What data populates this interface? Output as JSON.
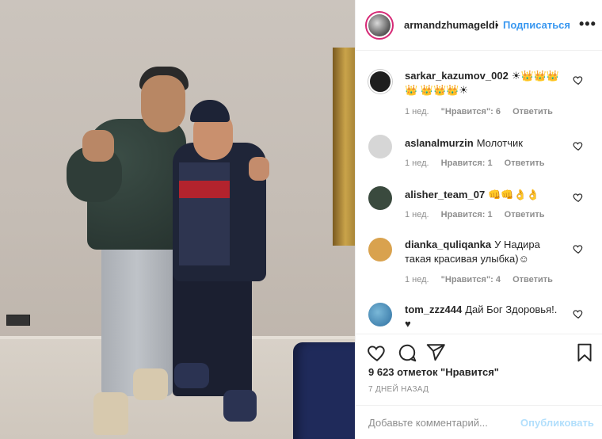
{
  "post": {
    "username": "armandzhumageldi",
    "separator": "•",
    "follow_label": "Подписаться",
    "more_label": "•••",
    "likes_text": "9 623 отметок \"Нравится\"",
    "time_ago": "7 ДНЕЙ НАЗАД"
  },
  "comments": [
    {
      "username": "sarkar_kazumov_002",
      "text": "☀👑👑👑👑 👑👑👑☀",
      "age": "1 нед.",
      "likes": "\"Нравится\": 6",
      "reply": "Ответить",
      "avatar_color": "#1e1e1e"
    },
    {
      "username": "aslanalmurzin",
      "text": "Молотчик",
      "age": "1 нед.",
      "likes": "Нравится: 1",
      "reply": "Ответить",
      "avatar_color": "#d6d6d6"
    },
    {
      "username": "alisher_team_07",
      "text": "👊👊👌👌",
      "age": "1 нед.",
      "likes": "Нравится: 1",
      "reply": "Ответить",
      "avatar_color": "#3a4a3e"
    },
    {
      "username": "dianka_quliqanka",
      "text": "У Надира такая красивая улыбка)☺",
      "age": "1 нед.",
      "likes": "\"Нравится\": 4",
      "reply": "Ответить",
      "avatar_color": "#d9a24e"
    },
    {
      "username": "tom_zzz444",
      "text": "Дай Бог Здоровья!. ♥",
      "age": "",
      "likes": "",
      "reply": "",
      "avatar_color": "#2e6fa0"
    }
  ],
  "add_comment": {
    "placeholder": "Добавьте комментарий...",
    "publish_label": "Опубликовать"
  },
  "colors": {
    "accent": "#3897f0",
    "publish_disabled": "#b2dffc",
    "meta": "#8e8e8e"
  },
  "icons": [
    "heart-icon",
    "comment-icon",
    "share-icon",
    "bookmark-icon",
    "more-icon"
  ]
}
